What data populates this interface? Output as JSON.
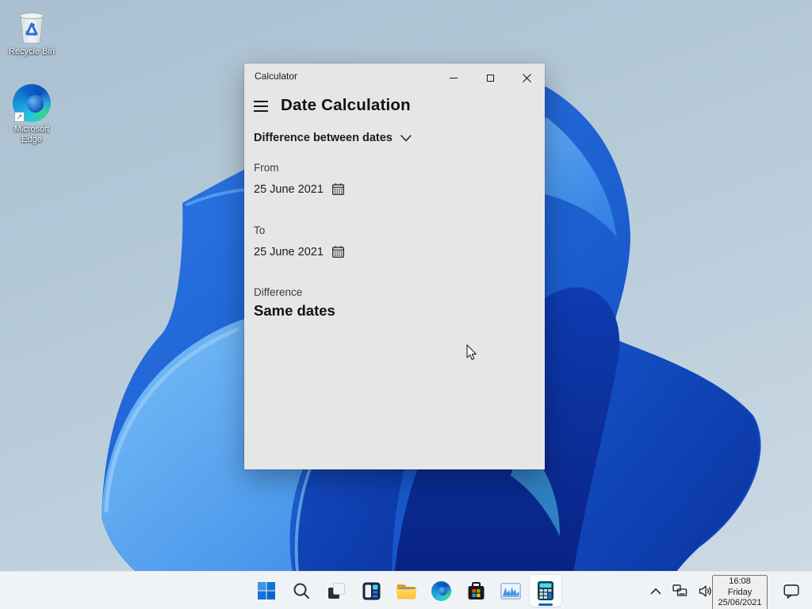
{
  "desktop": {
    "icons": [
      {
        "name": "recycle-bin",
        "label": "Recycle Bin"
      },
      {
        "name": "microsoft-edge",
        "label": "Microsoft Edge"
      }
    ]
  },
  "window": {
    "title": "Calculator",
    "nav_title": "Date Calculation",
    "mode_label": "Difference between dates",
    "from_label": "From",
    "from_value": "25 June 2021",
    "to_label": "To",
    "to_value": "25 June 2021",
    "difference_label": "Difference",
    "difference_value": "Same dates"
  },
  "taskbar": {
    "items": [
      {
        "name": "start"
      },
      {
        "name": "search"
      },
      {
        "name": "task-view"
      },
      {
        "name": "widgets"
      },
      {
        "name": "file-explorer"
      },
      {
        "name": "edge"
      },
      {
        "name": "microsoft-store"
      },
      {
        "name": "task-manager"
      },
      {
        "name": "calculator",
        "active": true
      }
    ],
    "tray": {
      "time": "16:08",
      "day": "Friday",
      "date": "25/06/2021"
    }
  },
  "colors": {
    "accent": "#0067c0",
    "window_bg": "#e6e6e6",
    "taskbar_bg": "#f0f3f6"
  }
}
